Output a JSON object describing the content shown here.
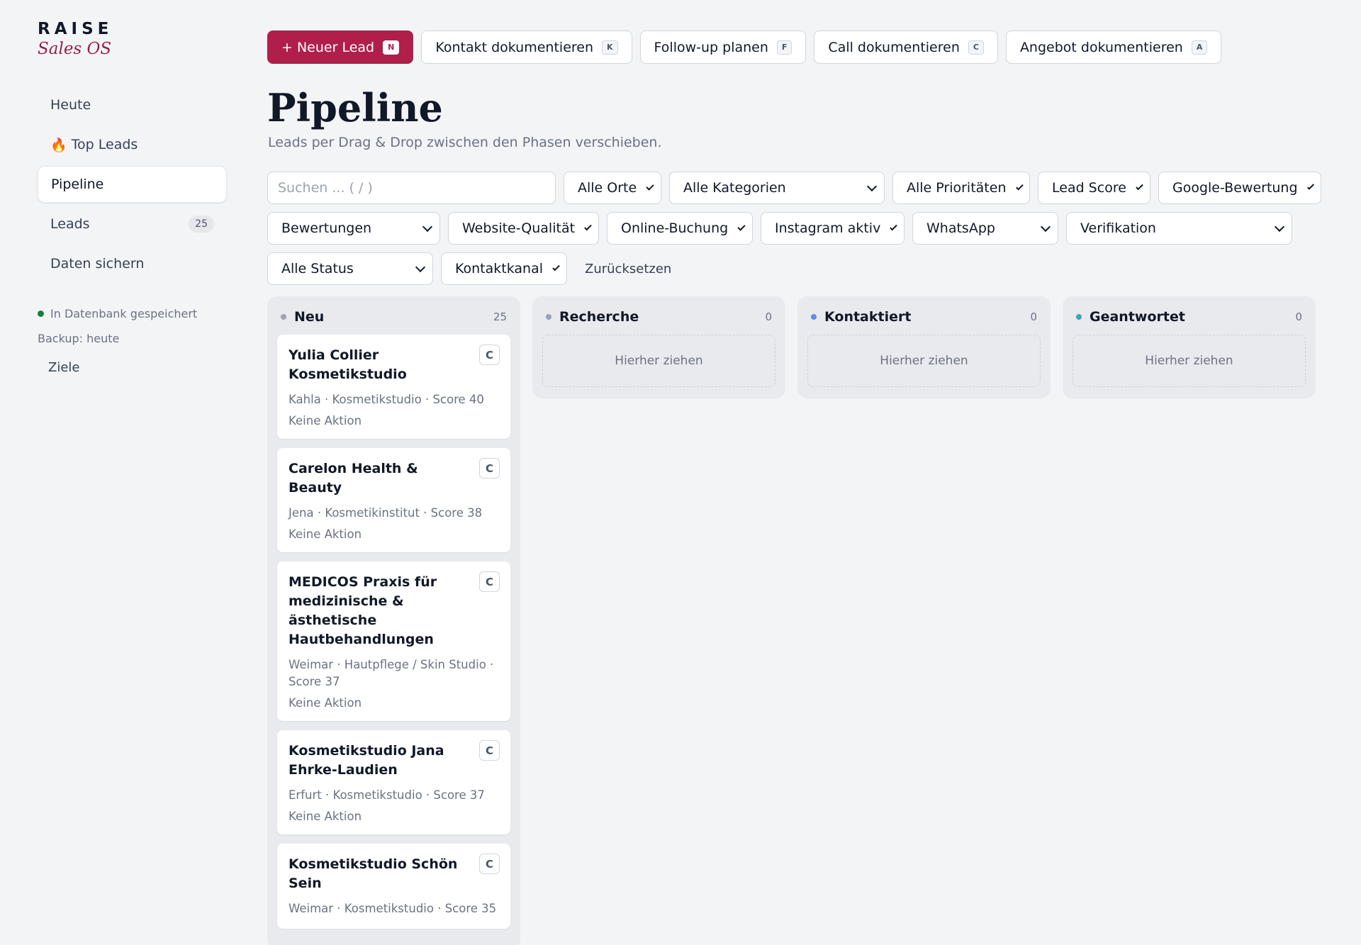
{
  "brand": {
    "name": "RAISE",
    "subtitle": "Sales OS"
  },
  "sidebar": {
    "items": [
      {
        "label": "Heute",
        "icon": "",
        "badge": ""
      },
      {
        "label": "Top Leads",
        "icon": "🔥",
        "badge": ""
      },
      {
        "label": "Pipeline",
        "icon": "",
        "badge": "",
        "active": true
      },
      {
        "label": "Leads",
        "icon": "",
        "badge": "25"
      },
      {
        "label": "Daten sichern",
        "icon": "",
        "badge": ""
      }
    ],
    "db_status": "In Datenbank gespeichert",
    "backup": "Backup: heute",
    "goals": "Ziele"
  },
  "actions": [
    {
      "label": "+ Neuer Lead",
      "key": "N",
      "primary": true
    },
    {
      "label": "Kontakt dokumentieren",
      "key": "K"
    },
    {
      "label": "Follow-up planen",
      "key": "F"
    },
    {
      "label": "Call dokumentieren",
      "key": "C"
    },
    {
      "label": "Angebot dokumentieren",
      "key": "A"
    }
  ],
  "page": {
    "title": "Pipeline",
    "subtitle": "Leads per Drag & Drop zwischen den Phasen verschieben."
  },
  "filters": {
    "search_placeholder": "Suchen ... ( / )",
    "row1": [
      "Alle Orte",
      "Alle Kategorien",
      "Alle Prioritäten",
      "Lead Score",
      "Google-Bewertung"
    ],
    "row2": [
      "Bewertungen",
      "Website-Qualität",
      "Online-Buchung",
      "Instagram aktiv",
      "WhatsApp",
      "Verifikation"
    ],
    "row3": [
      "Alle Status",
      "Kontaktkanal"
    ],
    "reset": "Zurücksetzen"
  },
  "columns": [
    {
      "title": "Neu",
      "count": "25",
      "dot_color": "#9ca3af",
      "cards": [
        {
          "title": "Yulia Collier Kosmetikstudio",
          "meta": "Kahla · Kosmetikstudio · Score 40",
          "action": "Keine Aktion",
          "button": "C"
        },
        {
          "title": "Carelon Health & Beauty",
          "meta": "Jena · Kosmetikinstitut · Score 38",
          "action": "Keine Aktion",
          "button": "C"
        },
        {
          "title": "MEDICOS Praxis für medizinische & ästhetische Hautbehandlungen",
          "meta": "Weimar · Hautpflege / Skin Studio · Score 37",
          "action": "Keine Aktion",
          "button": "C"
        },
        {
          "title": "Kosmetikstudio Jana Ehrke-Laudien",
          "meta": "Erfurt · Kosmetikstudio · Score 37",
          "action": "Keine Aktion",
          "button": "C"
        },
        {
          "title": "Kosmetikstudio Schön Sein",
          "meta": "Weimar · Kosmetikstudio · Score 35",
          "action": "",
          "button": "C"
        }
      ]
    },
    {
      "title": "Recherche",
      "count": "0",
      "dot_color": "#94a3b8",
      "dropzone": "Hierher ziehen"
    },
    {
      "title": "Kontaktiert",
      "count": "0",
      "dot_color": "#5b8def",
      "dropzone": "Hierher ziehen"
    },
    {
      "title": "Geantwortet",
      "count": "0",
      "dot_color": "#3aa6b9",
      "dropzone": "Hierher ziehen"
    }
  ]
}
